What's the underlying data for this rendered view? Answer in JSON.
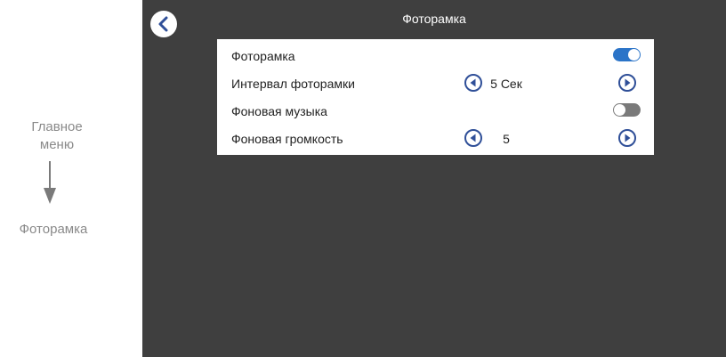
{
  "annotation": {
    "from_line1": "Главное",
    "from_line2": "меню",
    "to": "Фоторамка"
  },
  "screen": {
    "title": "Фоторамка",
    "back_icon": "chevron-left-icon"
  },
  "settings": [
    {
      "label": "Фоторамка",
      "control": "toggle",
      "state": "on"
    },
    {
      "label": "Интервал фоторамки",
      "control": "stepper",
      "value": "5 Сек"
    },
    {
      "label": "Фоновая музыка",
      "control": "toggle",
      "state": "off"
    },
    {
      "label": "Фоновая громкость",
      "control": "stepper",
      "value": "5"
    }
  ],
  "colors": {
    "screen_bg": "#3f3f3f",
    "toggle_on": "#2b74c8",
    "toggle_off": "#7a7a7a",
    "accent": "#2f4f98"
  }
}
